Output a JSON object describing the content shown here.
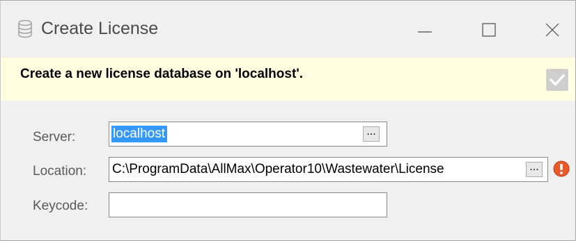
{
  "window": {
    "title": "Create License",
    "icon": "database-icon",
    "controls": [
      "minimize-icon",
      "maximize-icon",
      "close-icon"
    ]
  },
  "banner": {
    "message": "Create a new license database on 'localhost'.",
    "check_icon": "checkmark-icon",
    "background": "#ffffe2"
  },
  "form": {
    "server": {
      "label": "Server:",
      "value": "localhost",
      "selected": true,
      "browse_label": "..."
    },
    "location": {
      "label": "Location:",
      "value": "C:\\ProgramData\\AllMax\\Operator10\\Wastewater\\License",
      "browse_label": "...",
      "status_icon": "error-icon",
      "status_color": "#e8582a"
    },
    "keycode": {
      "label": "Keycode:",
      "value": ""
    }
  },
  "colors": {
    "selection": "#3399ff",
    "window_bg": "#f0f0f0"
  }
}
